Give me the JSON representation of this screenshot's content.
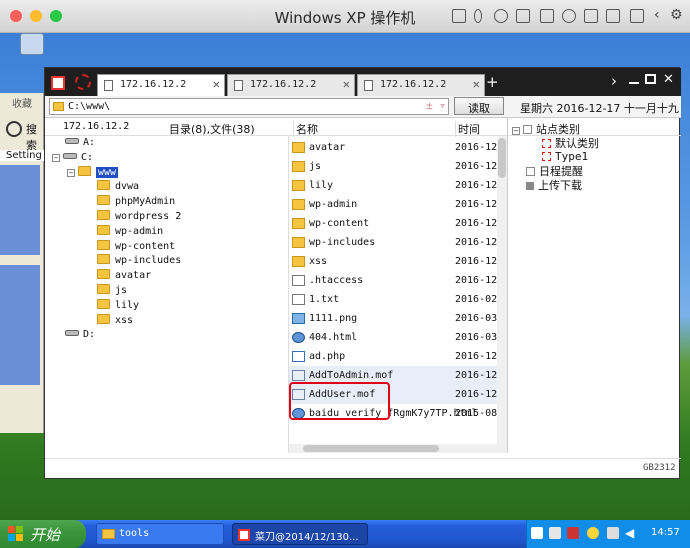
{
  "mac": {
    "title": "Windows XP 操作机"
  },
  "tabs": [
    {
      "label": "172.16.12.2"
    },
    {
      "label": "172.16.12.2"
    },
    {
      "label": "172.16.12.2"
    }
  ],
  "address": {
    "path": "C:\\www\\",
    "read_button": "读取",
    "date": "星期六 2016-12-17 十一月十九"
  },
  "header": {
    "host": "172.16.12.2",
    "counts": "目录(8),文件(38)",
    "col_name": "名称",
    "col_time": "时间"
  },
  "tree": {
    "drives": [
      "A:",
      "C:",
      "D:"
    ],
    "root_folder": "www",
    "folders": [
      "dvwa",
      "phpMyAdmin",
      "wordpress 2",
      "wp-admin",
      "wp-content",
      "wp-includes",
      "avatar",
      "js",
      "lily",
      "xss"
    ]
  },
  "files": [
    {
      "name": "avatar",
      "date": "2016-12-",
      "type": "folder"
    },
    {
      "name": "js",
      "date": "2016-12-",
      "type": "folder"
    },
    {
      "name": "lily",
      "date": "2016-12-",
      "type": "folder"
    },
    {
      "name": "wp-admin",
      "date": "2016-12-",
      "type": "folder"
    },
    {
      "name": "wp-content",
      "date": "2016-12-",
      "type": "folder"
    },
    {
      "name": "wp-includes",
      "date": "2016-12-",
      "type": "folder"
    },
    {
      "name": "xss",
      "date": "2016-12-",
      "type": "folder"
    },
    {
      "name": ".htaccess",
      "date": "2016-12-",
      "type": "file"
    },
    {
      "name": "1.txt",
      "date": "2016-02-",
      "type": "file"
    },
    {
      "name": "1111.png",
      "date": "2016-03-",
      "type": "image"
    },
    {
      "name": "404.html",
      "date": "2016-03-",
      "type": "html"
    },
    {
      "name": "ad.php",
      "date": "2016-12-",
      "type": "php"
    },
    {
      "name": "AddToAdmin.mof",
      "date": "2016-12-",
      "type": "mof"
    },
    {
      "name": "AddUser.mof",
      "date": "2016-12-",
      "type": "mof"
    },
    {
      "name": "baidu_verify_fRgmK7y7TP.html",
      "date": "2015-08-",
      "type": "html"
    }
  ],
  "right_panel": {
    "site_category": "站点类别",
    "default_category": "默认类别",
    "type1": "Type1",
    "reminder": "日程提醒",
    "upload_download": "上传下载"
  },
  "status": {
    "encoding": "GB2312"
  },
  "bg_window": {
    "left_text": "收藏",
    "search": "搜索",
    "settings": "Setting"
  },
  "taskbar": {
    "start": "开始",
    "task1": "tools",
    "task2": "菜刀@2014/12/130...",
    "clock": "14:57"
  },
  "colors": {
    "highlight": "#e0001a",
    "xp_blue": "#245edb",
    "start_green": "#3a963a"
  }
}
